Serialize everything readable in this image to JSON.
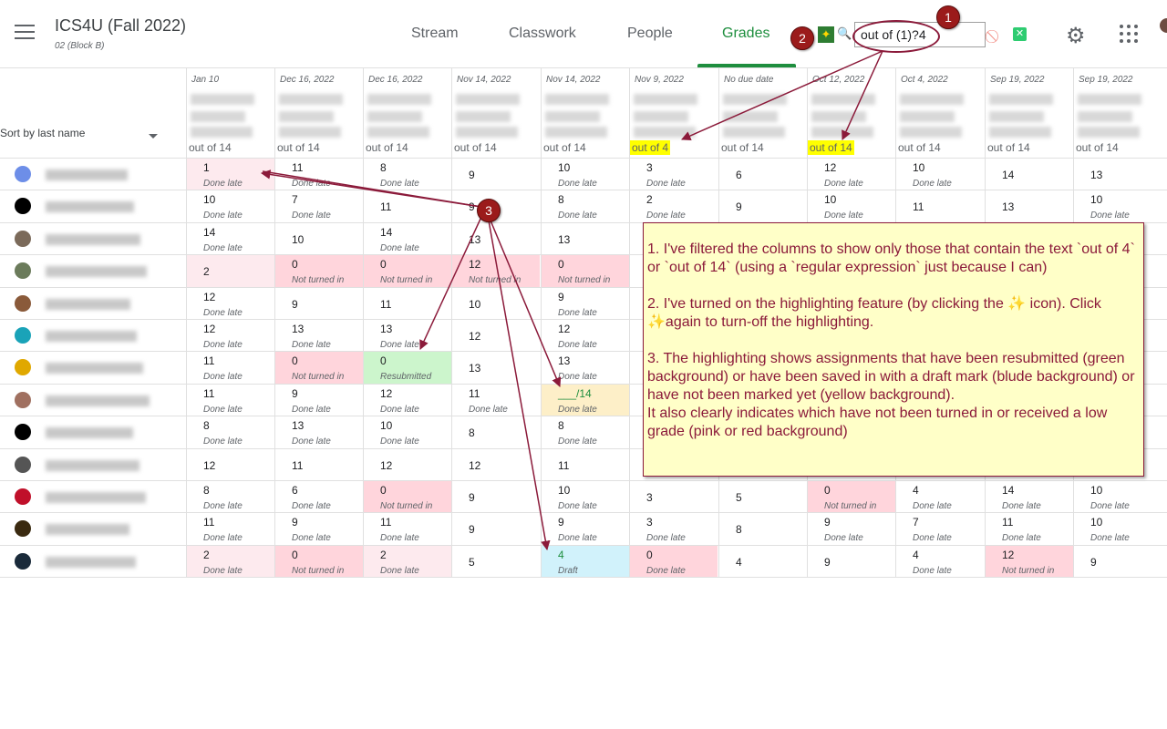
{
  "header": {
    "class_title": "ICS4U (Fall 2022)",
    "class_subtitle": "02 (Block B)",
    "tabs": [
      {
        "label": "Stream",
        "active": false
      },
      {
        "label": "Classwork",
        "active": false
      },
      {
        "label": "People",
        "active": false
      },
      {
        "label": "Grades",
        "active": true
      }
    ],
    "filter_value": "out of (1)?4",
    "accent_color": "#1e8e3e"
  },
  "callouts": [
    "1",
    "2",
    "3"
  ],
  "sort_label": "Sort by last name",
  "columns": [
    {
      "date": "Jan 10",
      "out_of": "out of 14",
      "highlight": false
    },
    {
      "date": "Dec 16, 2022",
      "out_of": "out of 14",
      "highlight": false
    },
    {
      "date": "Dec 16, 2022",
      "out_of": "out of 14",
      "highlight": false
    },
    {
      "date": "Nov 14, 2022",
      "out_of": "out of 14",
      "highlight": false
    },
    {
      "date": "Nov 14, 2022",
      "out_of": "out of 14",
      "highlight": false
    },
    {
      "date": "Nov 9, 2022",
      "out_of": "out of 4",
      "highlight": true
    },
    {
      "date": "No due date",
      "out_of": "out of 14",
      "highlight": false
    },
    {
      "date": "Oct 12, 2022",
      "out_of": "out of 14",
      "highlight": true
    },
    {
      "date": "Oct 4, 2022",
      "out_of": "out of 14",
      "highlight": false
    },
    {
      "date": "Sep 19, 2022",
      "out_of": "out of 14",
      "highlight": false
    },
    {
      "date": "Sep 19, 2022",
      "out_of": "out of 14",
      "highlight": false
    }
  ],
  "rows": [
    {
      "avatar": "#6d8ee8",
      "cells": [
        [
          "1",
          "Done late",
          "pink"
        ],
        [
          "11",
          "Done late",
          ""
        ],
        [
          "8",
          "Done late",
          ""
        ],
        [
          "9",
          "",
          ""
        ],
        [
          "10",
          "Done late",
          ""
        ],
        [
          "3",
          "Done late",
          ""
        ],
        [
          "6",
          "",
          ""
        ],
        [
          "12",
          "Done late",
          ""
        ],
        [
          "10",
          "Done late",
          ""
        ],
        [
          "14",
          "",
          ""
        ],
        [
          "13",
          "",
          ""
        ]
      ]
    },
    {
      "avatar": "#000000",
      "cells": [
        [
          "10",
          "Done late",
          ""
        ],
        [
          "7",
          "Done late",
          ""
        ],
        [
          "11",
          "",
          ""
        ],
        [
          "9",
          "",
          ""
        ],
        [
          "8",
          "Done late",
          ""
        ],
        [
          "2",
          "Done late",
          ""
        ],
        [
          "9",
          "",
          ""
        ],
        [
          "10",
          "Done late",
          ""
        ],
        [
          "11",
          "",
          ""
        ],
        [
          "13",
          "",
          ""
        ],
        [
          "10",
          "Done late",
          ""
        ]
      ]
    },
    {
      "avatar": "#7b6a5a",
      "cells": [
        [
          "14",
          "Done late",
          ""
        ],
        [
          "10",
          "",
          ""
        ],
        [
          "14",
          "Done late",
          ""
        ],
        [
          "13",
          "",
          ""
        ],
        [
          "13",
          "",
          ""
        ],
        [
          "",
          "",
          ""
        ],
        [
          "",
          "",
          ""
        ],
        [
          "",
          "",
          ""
        ],
        [
          "",
          "",
          ""
        ],
        [
          "",
          "",
          ""
        ],
        [
          "",
          "",
          ""
        ]
      ]
    },
    {
      "avatar": "#6b7b5b",
      "cells": [
        [
          "2",
          "",
          "pink"
        ],
        [
          "0",
          "Not turned in",
          "red"
        ],
        [
          "0",
          "Not turned in",
          "red"
        ],
        [
          "12",
          "Not turned in",
          "red"
        ],
        [
          "0",
          "Not turned in",
          "red"
        ],
        [
          "",
          "",
          ""
        ],
        [
          "",
          "",
          ""
        ],
        [
          "",
          "",
          ""
        ],
        [
          "",
          "",
          ""
        ],
        [
          "",
          "",
          ""
        ],
        [
          "",
          "",
          ""
        ]
      ]
    },
    {
      "avatar": "#8a5a3a",
      "cells": [
        [
          "12",
          "Done late",
          ""
        ],
        [
          "9",
          "",
          ""
        ],
        [
          "11",
          "",
          ""
        ],
        [
          "10",
          "",
          ""
        ],
        [
          "9",
          "Done late",
          ""
        ],
        [
          "",
          "",
          ""
        ],
        [
          "",
          "",
          ""
        ],
        [
          "",
          "",
          ""
        ],
        [
          "",
          "",
          ""
        ],
        [
          "",
          "",
          ""
        ],
        [
          "",
          "",
          ""
        ]
      ]
    },
    {
      "avatar": "#1aa3b8",
      "cells": [
        [
          "12",
          "Done late",
          ""
        ],
        [
          "13",
          "Done late",
          ""
        ],
        [
          "13",
          "Done late",
          ""
        ],
        [
          "12",
          "",
          ""
        ],
        [
          "12",
          "Done late",
          ""
        ],
        [
          "",
          "",
          ""
        ],
        [
          "",
          "",
          ""
        ],
        [
          "",
          "",
          ""
        ],
        [
          "",
          "",
          ""
        ],
        [
          "",
          "",
          ""
        ],
        [
          "",
          "",
          ""
        ]
      ]
    },
    {
      "avatar": "#e0a800",
      "cells": [
        [
          "11",
          "Done late",
          ""
        ],
        [
          "0",
          "Not turned in",
          "red"
        ],
        [
          "0",
          "Resubmitted",
          "green"
        ],
        [
          "13",
          "",
          ""
        ],
        [
          "13",
          "Done late",
          ""
        ],
        [
          "",
          "",
          ""
        ],
        [
          "",
          "",
          ""
        ],
        [
          "",
          "",
          ""
        ],
        [
          "",
          "",
          ""
        ],
        [
          "",
          "",
          ""
        ],
        [
          "",
          "",
          ""
        ]
      ]
    },
    {
      "avatar": "#a07060",
      "cells": [
        [
          "11",
          "Done late",
          ""
        ],
        [
          "9",
          "Done late",
          ""
        ],
        [
          "12",
          "Done late",
          ""
        ],
        [
          "11",
          "Done late",
          ""
        ],
        [
          "___/14",
          "Done late",
          "yellow"
        ],
        [
          "",
          "",
          ""
        ],
        [
          "",
          "",
          ""
        ],
        [
          "",
          "",
          ""
        ],
        [
          "",
          "",
          ""
        ],
        [
          "",
          "",
          ""
        ],
        [
          "",
          "",
          ""
        ]
      ]
    },
    {
      "avatar": "#000000",
      "cells": [
        [
          "8",
          "Done late",
          ""
        ],
        [
          "13",
          "Done late",
          ""
        ],
        [
          "10",
          "Done late",
          ""
        ],
        [
          "8",
          "",
          ""
        ],
        [
          "8",
          "Done late",
          ""
        ],
        [
          "",
          "",
          ""
        ],
        [
          "",
          "",
          ""
        ],
        [
          "",
          "",
          ""
        ],
        [
          "",
          "",
          ""
        ],
        [
          "",
          "",
          ""
        ],
        [
          "",
          "",
          ""
        ]
      ]
    },
    {
      "avatar": "#555555",
      "cells": [
        [
          "12",
          "",
          ""
        ],
        [
          "11",
          "",
          ""
        ],
        [
          "12",
          "",
          ""
        ],
        [
          "12",
          "",
          ""
        ],
        [
          "11",
          "",
          ""
        ],
        [
          "",
          "",
          ""
        ],
        [
          "",
          "",
          ""
        ],
        [
          "",
          "",
          ""
        ],
        [
          "",
          "",
          ""
        ],
        [
          "",
          "",
          ""
        ],
        [
          "",
          "",
          ""
        ]
      ]
    },
    {
      "avatar": "#c0102a",
      "cells": [
        [
          "8",
          "Done late",
          ""
        ],
        [
          "6",
          "Done late",
          ""
        ],
        [
          "0",
          "Not turned in",
          "red"
        ],
        [
          "9",
          "",
          ""
        ],
        [
          "10",
          "Done late",
          ""
        ],
        [
          "3",
          "",
          ""
        ],
        [
          "5",
          "",
          ""
        ],
        [
          "0",
          "Not turned in",
          "red"
        ],
        [
          "4",
          "Done late",
          ""
        ],
        [
          "14",
          "Done late",
          ""
        ],
        [
          "10",
          "Done late",
          ""
        ]
      ]
    },
    {
      "avatar": "#3a2a10",
      "cells": [
        [
          "11",
          "Done late",
          ""
        ],
        [
          "9",
          "Done late",
          ""
        ],
        [
          "11",
          "Done late",
          ""
        ],
        [
          "9",
          "",
          ""
        ],
        [
          "9",
          "Done late",
          ""
        ],
        [
          "3",
          "Done late",
          ""
        ],
        [
          "8",
          "",
          ""
        ],
        [
          "9",
          "Done late",
          ""
        ],
        [
          "7",
          "Done late",
          ""
        ],
        [
          "11",
          "Done late",
          ""
        ],
        [
          "10",
          "Done late",
          ""
        ]
      ]
    },
    {
      "avatar": "#1a2a3a",
      "cells": [
        [
          "2",
          "Done late",
          "pink"
        ],
        [
          "0",
          "Not turned in",
          "red"
        ],
        [
          "2",
          "Done late",
          "pink"
        ],
        [
          "5",
          "",
          ""
        ],
        [
          "4",
          "Draft",
          "blue"
        ],
        [
          "0",
          "Done late",
          "red"
        ],
        [
          "4",
          "",
          ""
        ],
        [
          "9",
          "",
          ""
        ],
        [
          "4",
          "Done late",
          ""
        ],
        [
          "12",
          "Not turned in",
          "red"
        ],
        [
          "9",
          "",
          ""
        ]
      ]
    }
  ],
  "note": {
    "p1": "1. I've filtered the columns to show only those that contain the text `out of 4` or `out of 14` (using a `regular expression` just because I can)",
    "p2": "2. I've turned on the highlighting feature (by clicking the ✨ icon). Click ✨again to turn-off the highlighting.",
    "p3a": "3. The highlighting shows assignments that have been resubmitted (green background) or have been saved in with a draft mark (blude background) or have not been marked yet (yellow background).",
    "p3b": "It also clearly indicates which have not been turned in or received a low grade (pink or red background)"
  }
}
